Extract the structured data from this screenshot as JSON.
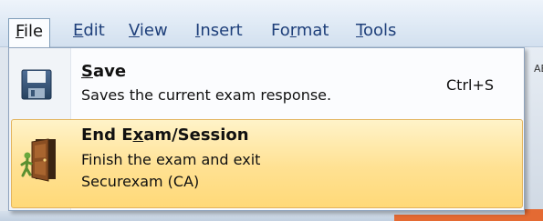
{
  "menubar": {
    "items": [
      {
        "pre": "",
        "ul": "F",
        "post": "ile"
      },
      {
        "pre": "",
        "ul": "E",
        "post": "dit"
      },
      {
        "pre": "",
        "ul": "V",
        "post": "iew"
      },
      {
        "pre": "",
        "ul": "I",
        "post": "nsert"
      },
      {
        "pre": "Fo",
        "ul": "r",
        "post": "mat"
      },
      {
        "pre": "",
        "ul": "T",
        "post": "ools"
      }
    ]
  },
  "file_menu": {
    "save": {
      "title_ul": "S",
      "title_rest": "ave",
      "description": "Saves the current exam response.",
      "shortcut": "Ctrl+S",
      "icon": "floppy-disk-icon"
    },
    "end_exam": {
      "title_pre": "End E",
      "title_ul": "x",
      "title_post": "am/Session",
      "description": "Finish the exam and exit\nSecurexam (CA)",
      "icon": "exit-door-icon",
      "highlight_color": "#ffe192"
    }
  },
  "background": {
    "toolbar_fragment": "AB",
    "accent_color": "#e46a33"
  }
}
